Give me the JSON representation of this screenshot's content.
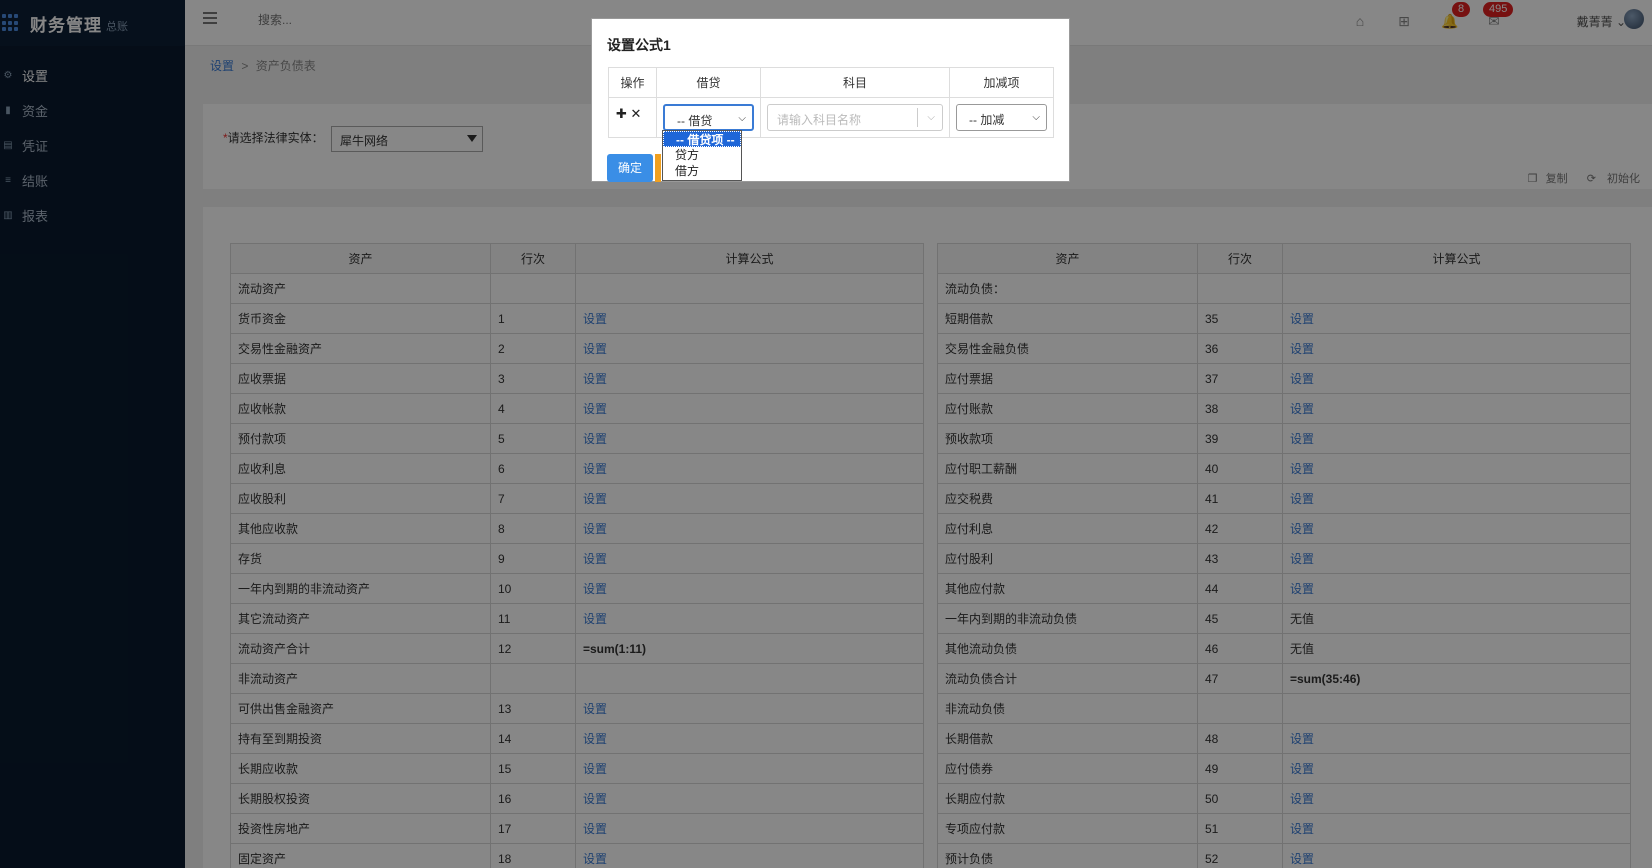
{
  "app": {
    "title": "财务管理",
    "subtitle": "总账"
  },
  "sidebar": {
    "items": [
      {
        "label": "设置",
        "icon": "gear-icon"
      },
      {
        "label": "资金",
        "icon": "bar-icon"
      },
      {
        "label": "凭证",
        "icon": "document-icon"
      },
      {
        "label": "结账",
        "icon": "list-icon"
      },
      {
        "label": "报表",
        "icon": "chart-icon"
      }
    ]
  },
  "header": {
    "search_placeholder": "搜索...",
    "notifications_count": "8",
    "messages_count": "495",
    "user_name": "戴菁菁"
  },
  "breadcrumb": {
    "root": "设置",
    "sep": ">",
    "current": "资产负债表"
  },
  "filter": {
    "label": "请选择法律实体：",
    "required_mark": "*",
    "entity": "犀牛网络",
    "copy_label": "复制",
    "init_label": "初始化"
  },
  "left_table": {
    "headers": [
      "资产",
      "行次",
      "计算公式"
    ],
    "rows": [
      [
        "流动资产",
        "",
        ""
      ],
      [
        "货币资金",
        "1",
        "设置"
      ],
      [
        "交易性金融资产",
        "2",
        "设置"
      ],
      [
        "应收票据",
        "3",
        "设置"
      ],
      [
        "应收帐款",
        "4",
        "设置"
      ],
      [
        "预付款项",
        "5",
        "设置"
      ],
      [
        "应收利息",
        "6",
        "设置"
      ],
      [
        "应收股利",
        "7",
        "设置"
      ],
      [
        "其他应收款",
        "8",
        "设置"
      ],
      [
        "存货",
        "9",
        "设置"
      ],
      [
        "一年内到期的非流动资产",
        "10",
        "设置"
      ],
      [
        "其它流动资产",
        "11",
        "设置"
      ],
      [
        "流动资产合计",
        "12",
        "=sum(1:11)"
      ],
      [
        "非流动资产",
        "",
        ""
      ],
      [
        "可供出售金融资产",
        "13",
        "设置"
      ],
      [
        "持有至到期投资",
        "14",
        "设置"
      ],
      [
        "长期应收款",
        "15",
        "设置"
      ],
      [
        "长期股权投资",
        "16",
        "设置"
      ],
      [
        "投资性房地产",
        "17",
        "设置"
      ],
      [
        "固定资产",
        "18",
        "设置"
      ]
    ]
  },
  "right_table": {
    "headers": [
      "资产",
      "行次",
      "计算公式"
    ],
    "rows": [
      [
        "流动负债：",
        "",
        ""
      ],
      [
        "短期借款",
        "35",
        "设置"
      ],
      [
        "交易性金融负债",
        "36",
        "设置"
      ],
      [
        "应付票据",
        "37",
        "设置"
      ],
      [
        "应付账款",
        "38",
        "设置"
      ],
      [
        "预收款项",
        "39",
        "设置"
      ],
      [
        "应付职工薪酬",
        "40",
        "设置"
      ],
      [
        "应交税费",
        "41",
        "设置"
      ],
      [
        "应付利息",
        "42",
        "设置"
      ],
      [
        "应付股利",
        "43",
        "设置"
      ],
      [
        "其他应付款",
        "44",
        "设置"
      ],
      [
        "一年内到期的非流动负债",
        "45",
        "无值"
      ],
      [
        "其他流动负债",
        "46",
        "无值"
      ],
      [
        "流动负债合计",
        "47",
        "=sum(35:46)"
      ],
      [
        "非流动负债",
        "",
        ""
      ],
      [
        "长期借款",
        "48",
        "设置"
      ],
      [
        "应付债券",
        "49",
        "设置"
      ],
      [
        "长期应付款",
        "50",
        "设置"
      ],
      [
        "专项应付款",
        "51",
        "设置"
      ],
      [
        "预计负债",
        "52",
        "设置"
      ]
    ]
  },
  "modal": {
    "title": "设置公式1",
    "headers": [
      "操作",
      "借贷",
      "科目",
      "加减项"
    ],
    "ops": "✚ ✕",
    "debit_credit_value": "-- 借贷",
    "subject_placeholder": "请输入科目名称",
    "plus_minus_value": "-- 加减",
    "ok_label": "确定"
  },
  "dropdown": {
    "options": [
      "-- 借贷项 --",
      "贷方",
      "借方"
    ],
    "selected_index": 0
  }
}
